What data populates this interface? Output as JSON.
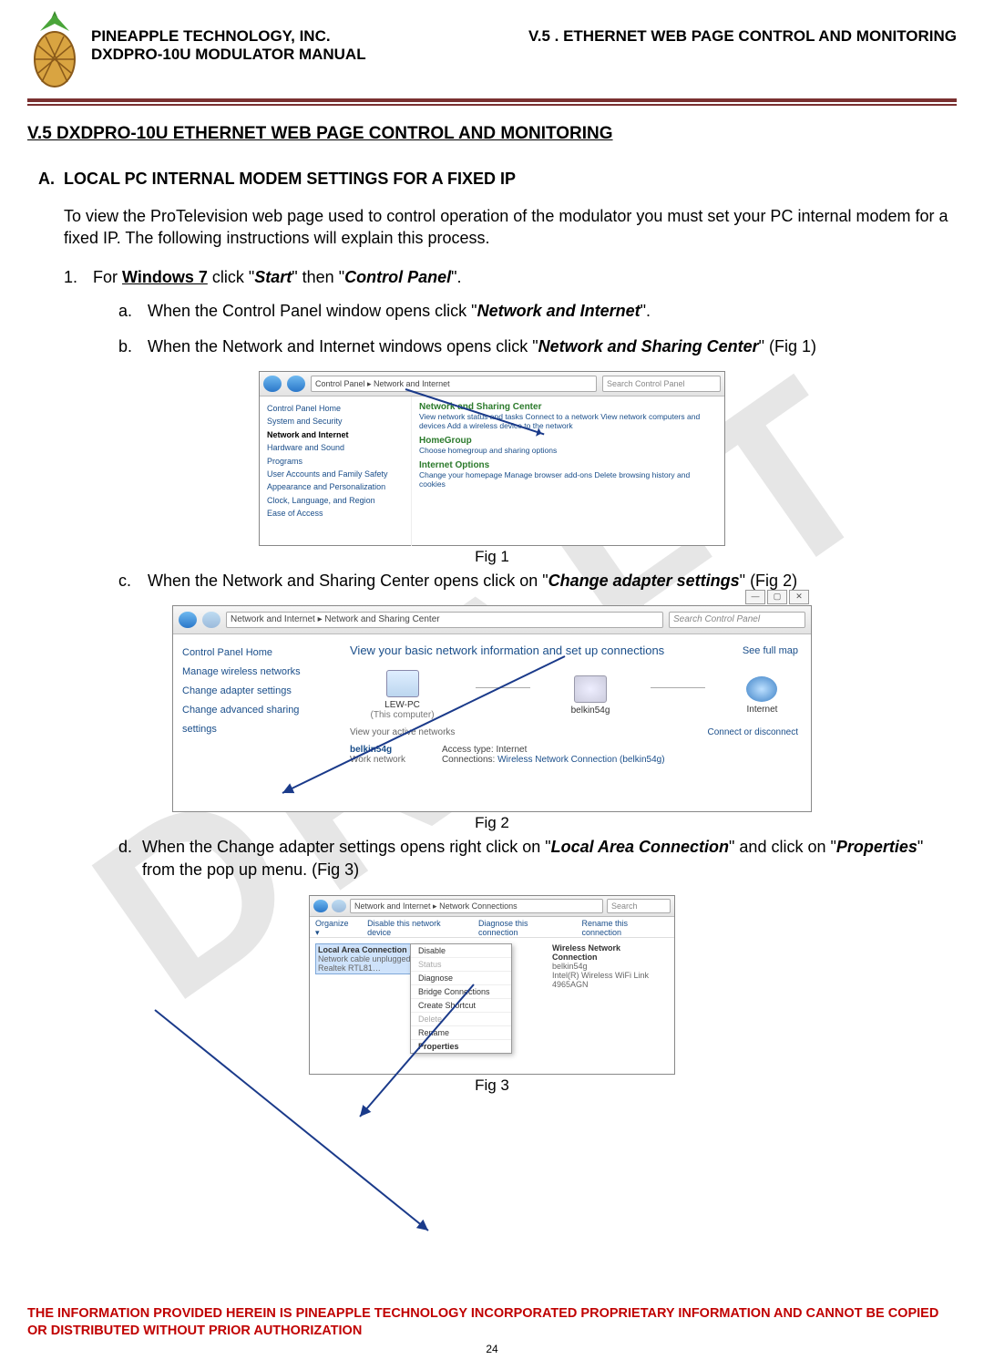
{
  "header": {
    "company": "PINEAPPLE TECHNOLOGY, INC.",
    "manual": "DXDPRO-10U MODULATOR MANUAL",
    "section_ref": "V.5 . ETHERNET WEB PAGE CONTROL AND MONITORING"
  },
  "watermark": "DRAFT",
  "section_title": "V.5  DXDPRO-10U ETHERNET WEB PAGE CONTROL AND MONITORING",
  "sub": {
    "letter": "A.",
    "title": "LOCAL PC INTERNAL MODEM SETTINGS FOR A FIXED IP"
  },
  "intro": "To view the ProTelevision web page used to control operation of the modulator you must set your PC internal modem for a fixed IP.  The following instructions will explain this process.",
  "step1": {
    "num": "1.",
    "pre": "For ",
    "os": "Windows 7",
    "mid1": " click \"",
    "start": "Start",
    "mid2": "\" then \"",
    "cp": "Control Panel",
    "end": "\"."
  },
  "s_a": {
    "let": "a.",
    "pre": "When the Control Panel window opens click \"",
    "bi": "Network and Internet",
    "end": "\"."
  },
  "s_b": {
    "let": "b.",
    "pre": "When the Network and Internet windows opens click \"",
    "bi": "Network and Sharing Center",
    "end": "\" (Fig 1)"
  },
  "fig1": {
    "caption": "Fig 1",
    "addr": "Control Panel  ▸  Network and Internet",
    "search": "Search Control Panel",
    "side": {
      "home": "Control Panel Home",
      "sys": "System and Security",
      "net": "Network and Internet",
      "hw": "Hardware and Sound",
      "prog": "Programs",
      "ua": "User Accounts and Family Safety",
      "app": "Appearance and Personalization",
      "clk": "Clock, Language, and Region",
      "eoa": "Ease of Access"
    },
    "main": {
      "nsc": "Network and Sharing Center",
      "nsc_d": "View network status and tasks     Connect to a network     View network computers and devices     Add a wireless device to the network",
      "hg": "HomeGroup",
      "hg_d": "Choose homegroup and sharing options",
      "io": "Internet Options",
      "io_d": "Change your homepage     Manage browser add-ons     Delete browsing history and cookies"
    }
  },
  "s_c": {
    "let": "c.",
    "pre": "When the Network and Sharing Center opens click on \"",
    "bi": "Change adapter settings",
    "end": "\" (Fig 2)"
  },
  "fig2": {
    "caption": "Fig 2",
    "addr": "Network and Internet  ▸  Network and Sharing Center",
    "search": "Search Control Panel",
    "side": {
      "home": "Control Panel Home",
      "mwn": "Manage wireless networks",
      "cas": "Change adapter settings",
      "cass": "Change advanced sharing settings"
    },
    "title": "View your basic network information and set up connections",
    "seefull": "See full map",
    "pc": "LEW-PC",
    "pc_sub": "(This computer)",
    "router": "belkin54g",
    "inet": "Internet",
    "van": "View your active networks",
    "cod": "Connect or disconnect",
    "net_name": "belkin54g",
    "net_type": "Work network",
    "at": "Access type:",
    "at_v": "Internet",
    "cn": "Connections:",
    "cn_v": "Wireless Network Connection (belkin54g)"
  },
  "s_d": {
    "let": "d.",
    "pre": "When the Change adapter settings opens right click on \"",
    "bi1": "Local Area Connection",
    "mid": "\" and click on \"",
    "bi2": "Properties",
    "end": "\" from the pop up menu. (Fig 3)"
  },
  "fig3": {
    "caption": "Fig 3",
    "addr": "Network and Internet  ▸  Network Connections",
    "search": "Search",
    "tool": {
      "org": "Organize ▾",
      "dis": "Disable this network device",
      "diag": "Diagnose this connection",
      "ren": "Rename this connection"
    },
    "lac": "Local Area Connection",
    "lac_s1": "Network cable unplugged",
    "lac_s2": "Realtek RTL81…",
    "wnc": "Wireless Network Connection",
    "wnc_s1": "belkin54g",
    "wnc_s2": "Intel(R) Wireless WiFi Link 4965AGN",
    "ctx": {
      "disable": "Disable",
      "status": "Status",
      "diag": "Diagnose",
      "bridge": "Bridge Connections",
      "shortcut": "Create Shortcut",
      "delete": "Delete",
      "rename": "Rename",
      "properties": "Properties"
    }
  },
  "footer": {
    "line1": "THE INFORMATION PROVIDED HEREIN IS PINEAPPLE TECHNOLOGY INCORPORATED PROPRIETARY INFORMATION AND CANNOT BE COPIED OR DISTRIBUTED WITHOUT PRIOR AUTHORIZATION",
    "page": "24"
  }
}
